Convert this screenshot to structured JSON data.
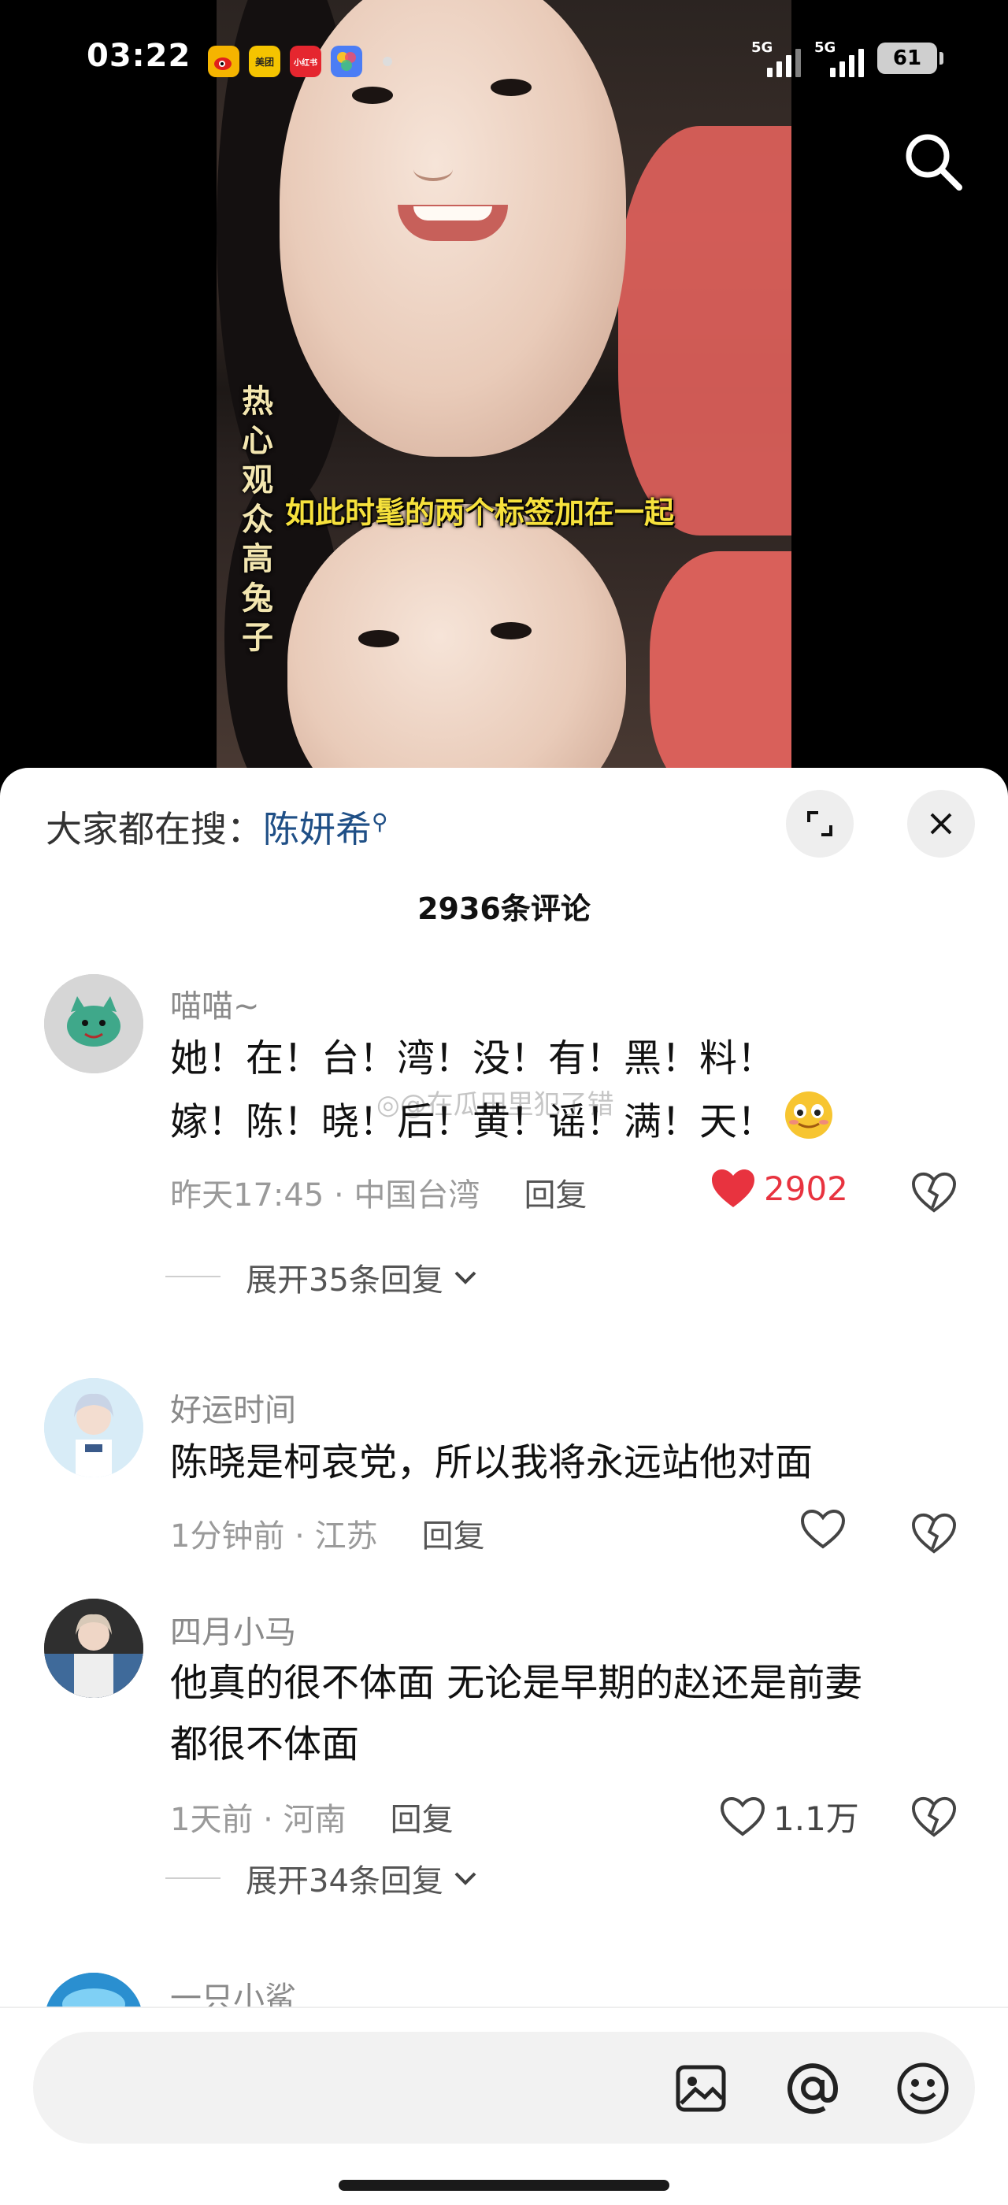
{
  "status_bar": {
    "time": "03:22",
    "apps": [
      {
        "name": "weibo-app-icon",
        "label": "",
        "color": "#f5b400"
      },
      {
        "name": "meituan-app-icon",
        "label": "美团",
        "color": "#f5c400"
      },
      {
        "name": "xiaohongshu-app-icon",
        "label": "小红书",
        "color": "#e5262f"
      },
      {
        "name": "photos-app-icon",
        "label": "",
        "color": "#4b7df5"
      }
    ],
    "signal1_label": "5G",
    "signal2_label": "5G",
    "battery": "61"
  },
  "video": {
    "vertical_caption": "热心观众高兔子",
    "subtitle": "如此时髦的两个标签加在一起"
  },
  "sheet": {
    "search_prefix": "大家都在搜：",
    "search_term": "陈妍希",
    "comment_count": "2936条评论"
  },
  "watermark": "@在瓜田里犯了错",
  "comments": [
    {
      "user": "喵喵~",
      "lines": [
        "她！在！台！湾！没！有！黑！料！",
        "嫁！陈！晓！后！黄！谣！满！天！"
      ],
      "time": "昨天17:45",
      "location": "中国台湾",
      "reply": "回复",
      "likes": "2902",
      "liked": true,
      "expand": "展开35条回复"
    },
    {
      "user": "好运时间",
      "lines": [
        "陈晓是柯哀党，所以我将永远站他对面"
      ],
      "time": "1分钟前",
      "location": "江苏",
      "reply": "回复",
      "likes": "",
      "liked": false
    },
    {
      "user": "四月小马",
      "lines": [
        "他真的很不体面 无论是早期的赵还是前妻",
        "都很不体面"
      ],
      "time": "1天前",
      "location": "河南",
      "reply": "回复",
      "likes": "1.1万",
      "liked": false,
      "expand": "展开34条回复"
    },
    {
      "user": "一只小鲨"
    }
  ],
  "input": {
    "placeholder": ""
  },
  "colors": {
    "accent_blue": "#1f4f86",
    "like_red": "#e8333f",
    "caption_yellow": "#f6e13c"
  }
}
